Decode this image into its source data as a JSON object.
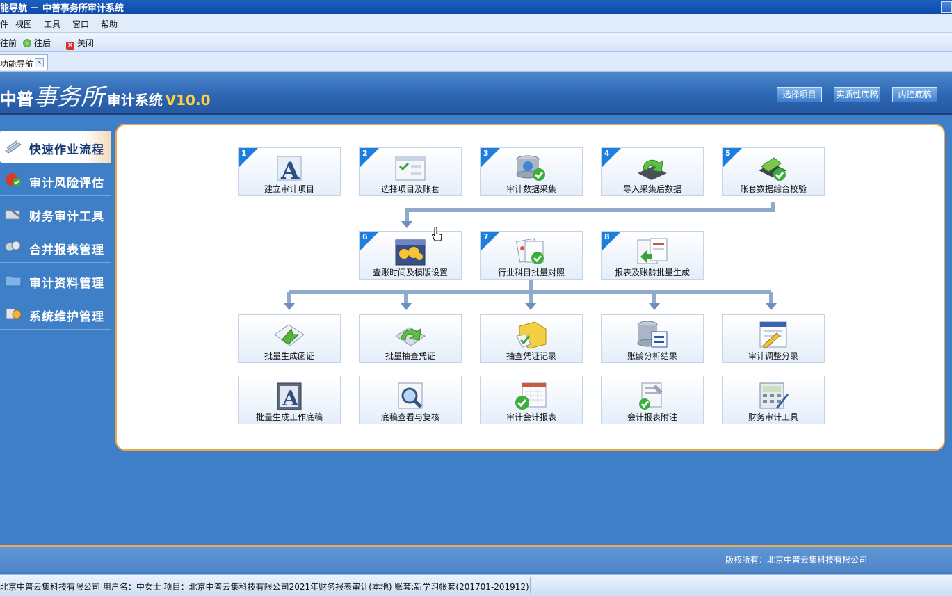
{
  "window": {
    "title": "能导航 － 中普事务所审计系统"
  },
  "menu": [
    "件",
    "视图",
    "工具",
    "窗口",
    "帮助"
  ],
  "toolbar": {
    "back_label": "往前",
    "forward_label": "往后",
    "close_label": "关闭"
  },
  "tab": {
    "label": "功能导航",
    "close": "×"
  },
  "logo": {
    "part1": "中普",
    "part2": "事务所",
    "part3": "审计系统",
    "version": "V10.0"
  },
  "header_buttons": [
    "选择项目",
    "实质性底稿",
    "内控底稿"
  ],
  "sidebar": [
    {
      "label": "快速作业流程",
      "active": true,
      "icon": "pen-icon"
    },
    {
      "label": "审计风险评估",
      "active": false,
      "icon": "risk-icon"
    },
    {
      "label": "财务审计工具",
      "active": false,
      "icon": "tools-icon"
    },
    {
      "label": "合并报表管理",
      "active": false,
      "icon": "merge-icon"
    },
    {
      "label": "审计资料管理",
      "active": false,
      "icon": "folder-icon"
    },
    {
      "label": "系统维护管理",
      "active": false,
      "icon": "system-icon"
    }
  ],
  "steps": [
    {
      "num": "1",
      "label": "建立审计项目",
      "icon": "letter-a-icon"
    },
    {
      "num": "2",
      "label": "选择项目及账套",
      "icon": "window-check-icon"
    },
    {
      "num": "3",
      "label": "审计数据采集",
      "icon": "database-globe-icon"
    },
    {
      "num": "4",
      "label": "导入采集后数据",
      "icon": "import-arrow-icon"
    },
    {
      "num": "5",
      "label": "账套数据综合校验",
      "icon": "verify-check-icon"
    },
    {
      "num": "6",
      "label": "查账时间及模版设置",
      "icon": "calendar-gear-icon"
    },
    {
      "num": "7",
      "label": "行业科目批量对照",
      "icon": "compare-check-icon"
    },
    {
      "num": "8",
      "label": "报表及账龄批量生成",
      "icon": "report-generate-icon"
    }
  ],
  "tools_row1": [
    {
      "label": "批量生成函证",
      "icon": "letter-envelope-icon"
    },
    {
      "label": "批量抽查凭证",
      "icon": "voucher-arrow-icon"
    },
    {
      "label": "抽查凭证记录",
      "icon": "folder-check-icon"
    },
    {
      "label": "账龄分析结果",
      "icon": "db-list-icon"
    },
    {
      "label": "审计调整分录",
      "icon": "edit-entry-icon"
    }
  ],
  "tools_row2": [
    {
      "label": "批量生成工作底稿",
      "icon": "workpaper-icon"
    },
    {
      "label": "底稿查看与复核",
      "icon": "magnifier-icon"
    },
    {
      "label": "审计会计报表",
      "icon": "calendar-check-icon"
    },
    {
      "label": "会计报表附注",
      "icon": "notes-icon"
    },
    {
      "label": "财务审计工具",
      "icon": "calculator-icon"
    }
  ],
  "copyright": "版权所有：北京中普云集科技有限公司",
  "status": "北京中普云集科技有限公司 用户名：中女士 项目：北京中普云集科技有限公司2021年财务报表审计(本地)    账套:新学习帐套(201701-201912)"
}
